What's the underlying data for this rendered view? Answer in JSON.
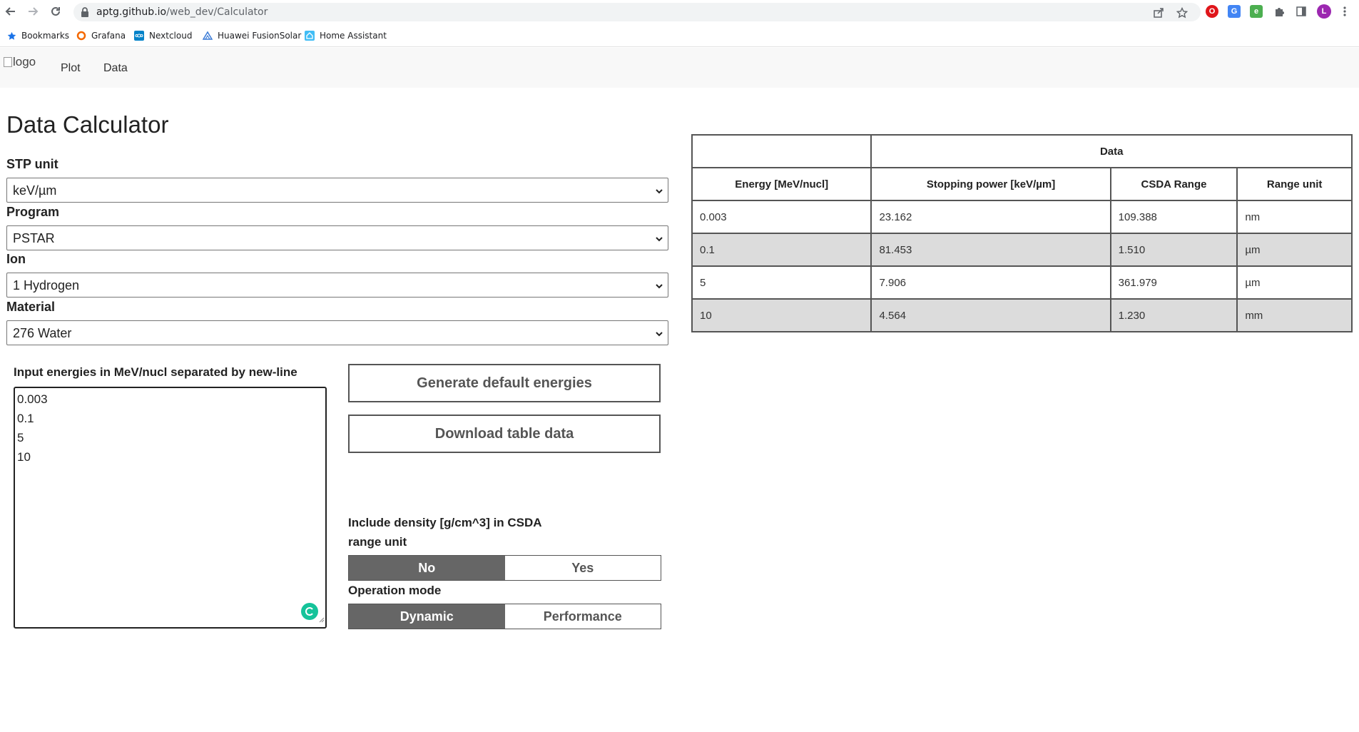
{
  "browser": {
    "url_host": "aptg.github.io",
    "url_path": "/web_dev/Calculator",
    "profile_initial": "L",
    "bookmarks": [
      {
        "label": "Bookmarks",
        "icon": "star-icon"
      },
      {
        "label": "Grafana",
        "icon": "grafana-icon"
      },
      {
        "label": "Nextcloud",
        "icon": "nextcloud-icon"
      },
      {
        "label": "Huawei FusionSolar",
        "icon": "fusionsolar-icon"
      },
      {
        "label": "Home Assistant",
        "icon": "home-assistant-icon"
      }
    ]
  },
  "nav": {
    "logo_alt": "logo",
    "links": [
      "Plot",
      "Data"
    ]
  },
  "page": {
    "title": "Data Calculator"
  },
  "form": {
    "stp_unit": {
      "label": "STP unit",
      "value": "keV/µm"
    },
    "program": {
      "label": "Program",
      "value": "PSTAR"
    },
    "ion": {
      "label": "Ion",
      "value": "1 Hydrogen"
    },
    "material": {
      "label": "Material",
      "value": "276 Water"
    }
  },
  "energies": {
    "label": "Input energies in MeV/nucl separated by new-line",
    "values": [
      "0.003",
      "0.1",
      "5",
      "10"
    ]
  },
  "buttons": {
    "generate": "Generate default energies",
    "download": "Download table data"
  },
  "density_toggle": {
    "label_line1": "Include density [g/cm^3] in CSDA",
    "label_line2": "range unit",
    "options": [
      "No",
      "Yes"
    ],
    "selected": "No"
  },
  "mode_toggle": {
    "label": "Operation mode",
    "options": [
      "Dynamic",
      "Performance"
    ],
    "selected": "Dynamic"
  },
  "table": {
    "group_header": "Data",
    "columns": [
      "Energy [MeV/nucl]",
      "Stopping power [keV/µm]",
      "CSDA Range",
      "Range unit"
    ],
    "rows": [
      [
        "0.003",
        "23.162",
        "109.388",
        "nm"
      ],
      [
        "0.1",
        "81.453",
        "1.510",
        "µm"
      ],
      [
        "5",
        "7.906",
        "361.979",
        "µm"
      ],
      [
        "10",
        "4.564",
        "1.230",
        "mm"
      ]
    ]
  },
  "colors": {
    "toggle_active": "#666666",
    "row_shade": "#dcdcdc",
    "navbar_bg": "#f8f8f8"
  }
}
